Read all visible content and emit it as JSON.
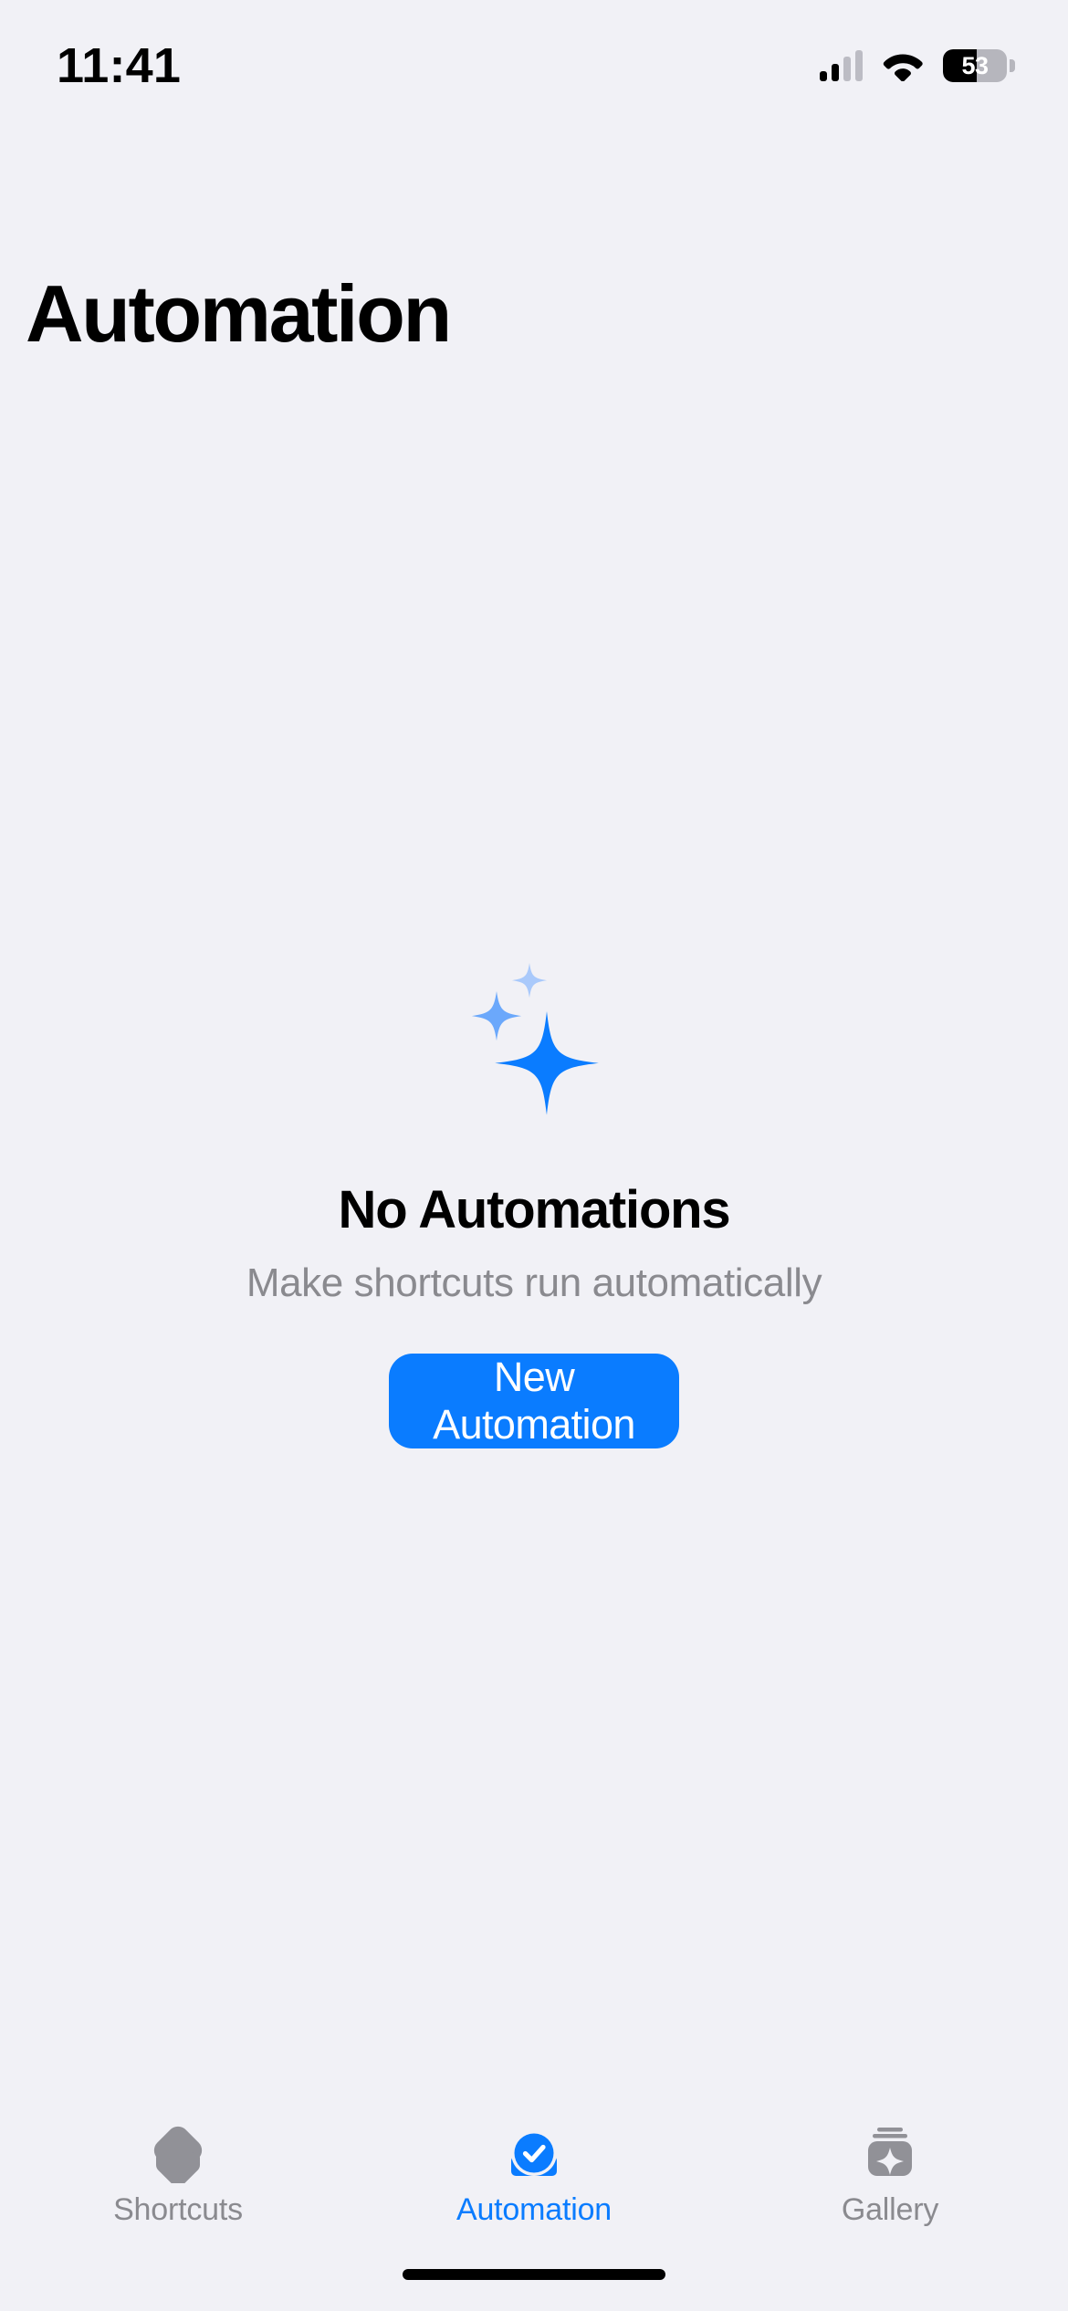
{
  "status_bar": {
    "time": "11:41",
    "cellular_icon": "cellular-signal-icon",
    "wifi_icon": "wifi-icon",
    "battery_percent_label": "53",
    "battery_level": 53
  },
  "header": {
    "title": "Automation"
  },
  "empty_state": {
    "icon": "sparkles-icon",
    "title": "No Automations",
    "subtitle": "Make shortcuts run automatically",
    "cta_label": "New Automation"
  },
  "tab_bar": {
    "tabs": [
      {
        "label": "Shortcuts",
        "icon": "shortcuts-stack-icon",
        "active": false
      },
      {
        "label": "Automation",
        "icon": "automation-check-icon",
        "active": true
      },
      {
        "label": "Gallery",
        "icon": "gallery-sparkle-icon",
        "active": false
      }
    ]
  },
  "colors": {
    "background": "#f1f1f6",
    "accent_blue": "#0a7cff",
    "sparkle_mid": "#6ba8fb",
    "sparkle_light": "#a9c9fb",
    "inactive_gray": "#8a8a8f",
    "icon_gray": "#919197"
  }
}
